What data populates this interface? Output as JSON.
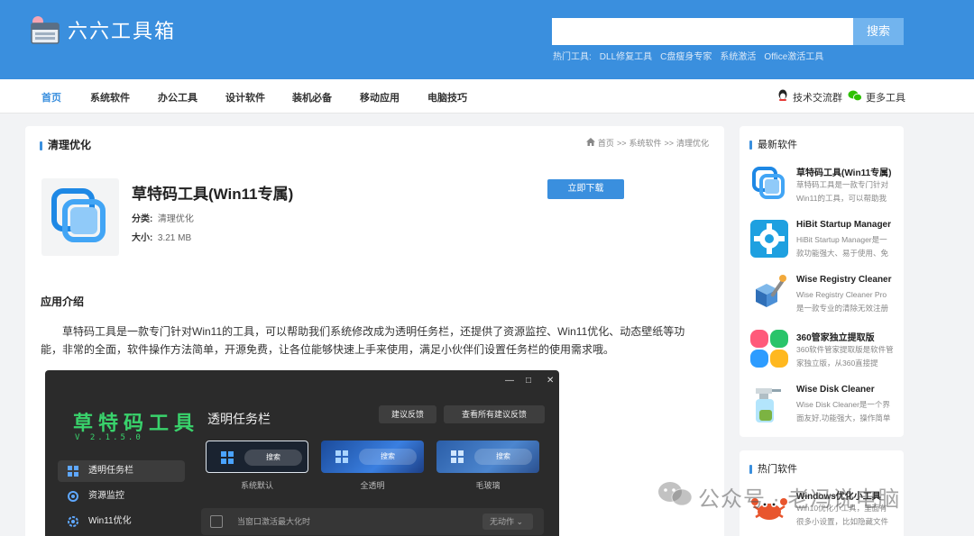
{
  "header": {
    "site_name": "六六工具箱",
    "search_button": "搜索",
    "search_placeholder": "",
    "hot_label": "热门工具:",
    "hot_links": [
      "DLL修复工具",
      "C盘瘦身专家",
      "系统激活",
      "Office激活工具"
    ]
  },
  "nav": {
    "items": [
      "首页",
      "系统软件",
      "办公工具",
      "设计软件",
      "装机必备",
      "移动应用",
      "电脑技巧"
    ],
    "active": "首页",
    "right": [
      "技术交流群",
      "更多工具"
    ]
  },
  "main": {
    "section_title": "清理优化",
    "breadcrumb": [
      "首页",
      ">>",
      "系统软件",
      ">>",
      "清理优化"
    ],
    "app": {
      "name": "草特码工具(Win11专属)",
      "category_label": "分类:",
      "category_value": "清理优化",
      "size_label": "大小:",
      "size_value": "3.21 MB",
      "download_button": "立即下载"
    },
    "intro_title": "应用介绍",
    "intro_text": "草特码工具是一款专门针对Win11的工具，可以帮助我们系统修改成为透明任务栏，还提供了资源监控、Win11优化、动态壁纸等功能，非常的全面，软件操作方法简单，开源免费，让各位能够快速上手来使用，满足小伙伴们设置任务栏的使用需求哦。"
  },
  "screenshot": {
    "title": "草特码工具",
    "version": "V 2.1.5.0",
    "menu": [
      "透明任务栏",
      "资源监控",
      "Win11优化"
    ],
    "heading": "透明任务栏",
    "buttons": [
      "建议反馈",
      "查看所有建议反馈"
    ],
    "taskbars": [
      {
        "search": "搜索",
        "label": "系统默认"
      },
      {
        "search": "搜索",
        "label": "全透明"
      },
      {
        "search": "搜索",
        "label": "毛玻璃"
      }
    ],
    "row_text": "当窗口激活最大化时",
    "row_select": "无动作",
    "window_controls": [
      "—",
      "□",
      "✕"
    ]
  },
  "sidebar": {
    "latest_title": "最新软件",
    "latest": [
      {
        "name": "草特码工具(Win11专属)",
        "desc": "草特码工具是一款专门针对Win11的工具，可以帮助我",
        "icon": "blue-squares-icon"
      },
      {
        "name": "HiBit Startup Manager",
        "desc": "HiBit Startup Manager是一款功能强大、易于使用、免",
        "icon": "gear-puzzle-icon"
      },
      {
        "name": "Wise Registry Cleaner",
        "desc": "Wise Registry Cleaner Pro是一款专业的清除无效注册",
        "icon": "registry-cubes-icon"
      },
      {
        "name": "360管家独立提取版",
        "desc": "360软件管家提取版是软件管家独立版，从360直接提",
        "icon": "colorful-petals-icon"
      },
      {
        "name": "Wise Disk Cleaner",
        "desc": "Wise Disk Cleaner是一个界面友好,功能强大，操作简单",
        "icon": "spray-bottle-icon"
      }
    ],
    "hot_title": "热门软件",
    "hot": [
      {
        "name": "Windows优化小工具",
        "desc": "Win10优化小工具，里面有很多小设置，比如隐藏文件",
        "icon": "crab-icon"
      }
    ]
  },
  "watermark": "公众号 · 老冯说电脑",
  "colors": {
    "brand": "#3a8fde",
    "header_bg": "#3a8fde",
    "search_btn": "#72b4ee",
    "green": "#39d36c"
  }
}
